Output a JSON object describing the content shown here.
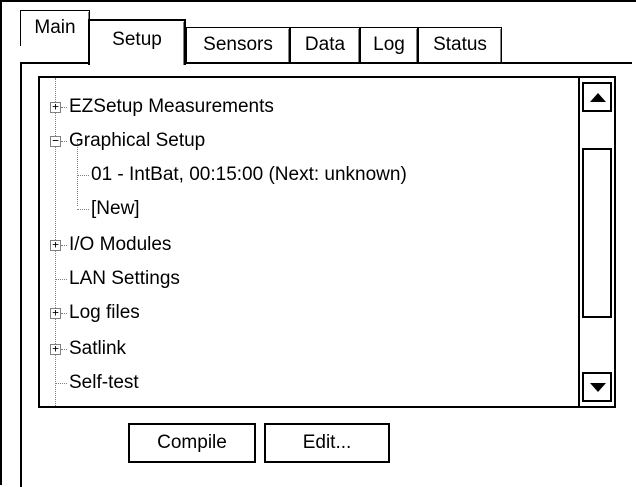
{
  "tabs": [
    {
      "label": "Main",
      "active": false
    },
    {
      "label": "Setup",
      "active": true
    },
    {
      "label": "Sensors",
      "active": false
    },
    {
      "label": "Data",
      "active": false
    },
    {
      "label": "Log",
      "active": false
    },
    {
      "label": "Status",
      "active": false
    }
  ],
  "tree": {
    "items": [
      {
        "label": "EZSetup Measurements",
        "expander": "+",
        "level": 0
      },
      {
        "label": "Graphical Setup",
        "expander": "−",
        "level": 0
      },
      {
        "label": "01 - IntBat, 00:15:00 (Next: unknown)",
        "expander": "",
        "level": 1
      },
      {
        "label": "[New]",
        "expander": "",
        "level": 1
      },
      {
        "label": "I/O Modules",
        "expander": "+",
        "level": 0
      },
      {
        "label": "LAN Settings",
        "expander": "",
        "level": 0
      },
      {
        "label": "Log files",
        "expander": "+",
        "level": 0
      },
      {
        "label": "Satlink",
        "expander": "+",
        "level": 0
      },
      {
        "label": "Self-test",
        "expander": "",
        "level": 0
      }
    ]
  },
  "buttons": {
    "compile": "Compile",
    "edit": "Edit..."
  },
  "icons": {
    "scroll_up": "scroll-up-arrow-icon",
    "scroll_down": "scroll-down-arrow-icon"
  }
}
